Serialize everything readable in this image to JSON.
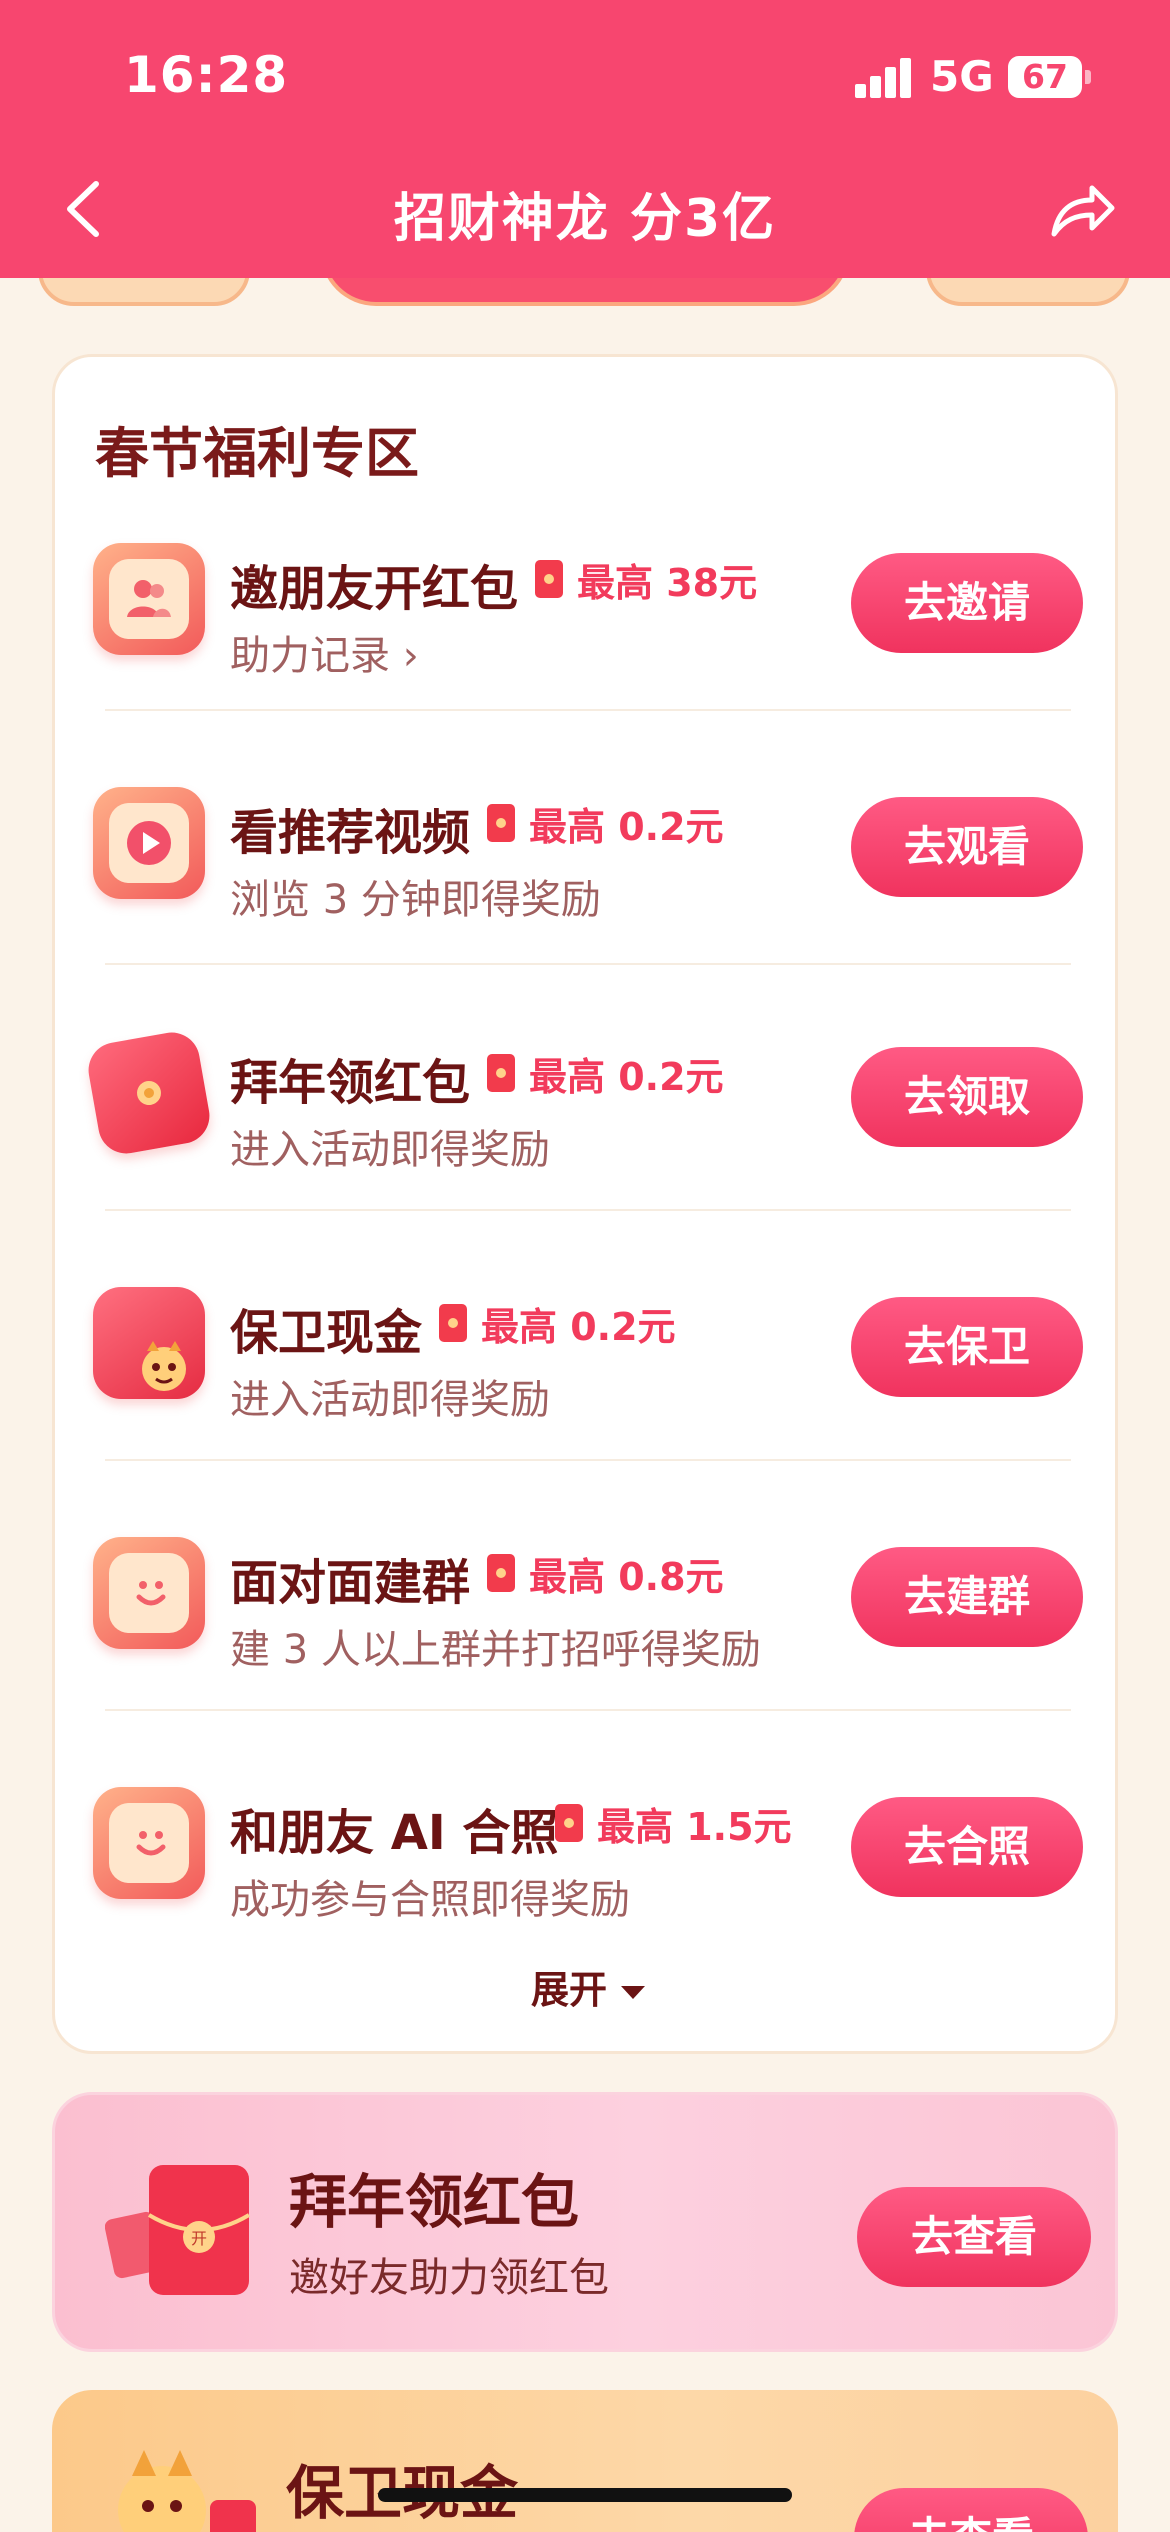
{
  "status_bar": {
    "time": "16:28",
    "network": "5G",
    "battery": "67"
  },
  "header": {
    "title": "招财神龙 分3亿",
    "back_icon": "back-arrow-icon",
    "share_icon": "share-icon",
    "background": "#f7466f"
  },
  "welfare": {
    "section_title": "春节福利专区",
    "tasks": [
      {
        "name": "邀朋友开红包",
        "reward": "最高 38元",
        "desc": "助力记录 ›",
        "button": "去邀请",
        "icon": "invite-friends-icon"
      },
      {
        "name": "看推荐视频",
        "reward": "最高 0.2元",
        "desc": "浏览 3 分钟即得奖励",
        "button": "去观看",
        "icon": "play-video-icon"
      },
      {
        "name": "拜年领红包",
        "reward": "最高 0.2元",
        "desc": "进入活动即得奖励",
        "button": "去领取",
        "icon": "red-envelope-icon"
      },
      {
        "name": "保卫现金",
        "reward": "最高 0.2元",
        "desc": "进入活动即得奖励",
        "button": "去保卫",
        "icon": "dragon-cash-icon"
      },
      {
        "name": "面对面建群",
        "reward": "最高 0.8元",
        "desc": "建 3 人以上群并打招呼得奖励",
        "button": "去建群",
        "icon": "smile-chat-icon"
      },
      {
        "name": "和朋友 AI 合照",
        "reward": "最高 1.5元",
        "desc": "成功参与合照即得奖励",
        "button": "去合照",
        "icon": "smile-chat-icon"
      }
    ],
    "expand_label": "展开"
  },
  "promos": [
    {
      "title": "拜年领红包",
      "subtitle": "邀好友助力领红包",
      "button": "去查看"
    },
    {
      "title": "保卫现金",
      "button": "去查看"
    }
  ],
  "colors": {
    "accent": "#f23b5c",
    "button": "#f0335e",
    "page_bg": "#fbf3e9",
    "dark_text": "#6b1414"
  }
}
